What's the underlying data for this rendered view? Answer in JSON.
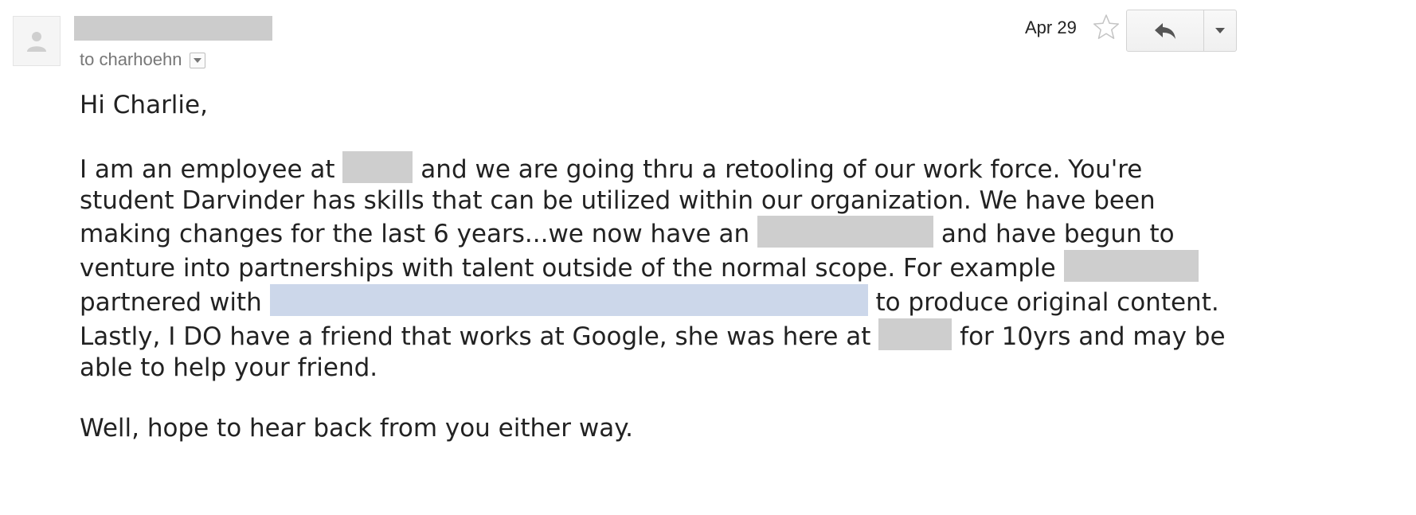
{
  "email": {
    "recipient_text": "to charhoehn",
    "date": "Apr 29",
    "greeting": "Hi Charlie,",
    "paragraph": {
      "part1": "I am an employee at",
      "part2": "and we are going thru a retooling of our work force. You're student Darvinder has skills that can be utilized within our organization. We have been making changes for the last 6 years...we now have an",
      "part3": "and have begun to venture into partnerships with talent outside of the normal scope. For example",
      "part4": "partnered with",
      "part5": "to produce original content. Lastly, I DO have a friend that works at Google, she was here at",
      "part6": "for 10yrs and may be able to help your friend."
    },
    "closing": "Well, hope to hear back from you either way."
  },
  "icons": {
    "avatar": "person-icon",
    "details": "chevron-down-icon",
    "star": "star-icon",
    "reply": "reply-arrow-icon",
    "more": "dropdown-arrow-icon"
  },
  "colors": {
    "redaction_gray": "#cccccc",
    "redaction_blue": "#ccd7ea",
    "secondary_text": "#777777"
  }
}
